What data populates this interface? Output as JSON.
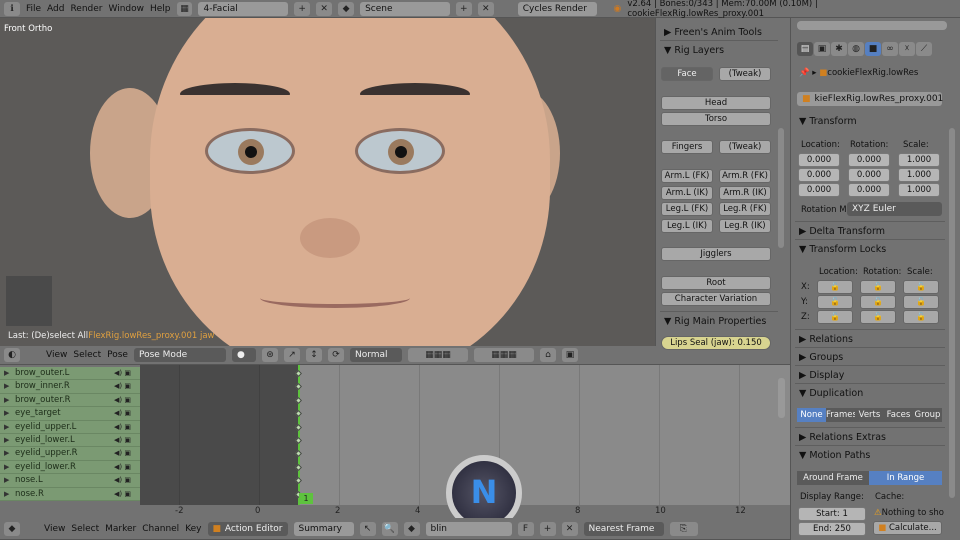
{
  "topbar": {
    "menus": [
      "File",
      "Add",
      "Render",
      "Window",
      "Help"
    ],
    "screen_layout": "4-Facial",
    "scene": "Scene",
    "render_engine": "Cycles Render",
    "stats": "v2.64 | Bones:0/343 | Mem:70.00M (0.10M) | cookieFlexRig.lowRes_proxy.001"
  },
  "viewport": {
    "view_label": "Front Ortho",
    "last_op": "Last: (De)select All",
    "object_info": "FlexRig.lowRes_proxy.001 jaw",
    "menus": [
      "View",
      "Select",
      "Pose"
    ],
    "mode": "Pose Mode",
    "orientation": "Normal"
  },
  "npanel": {
    "anim_tools": "Freen's Anim Tools",
    "rig_layers": "Rig Layers",
    "buttons": {
      "face": "Face",
      "tweak1": "(Tweak)",
      "head": "Head",
      "torso": "Torso",
      "fingers": "Fingers",
      "tweak2": "(Tweak)",
      "arm_l_fk": "Arm.L (FK)",
      "arm_r_fk": "Arm.R (FK)",
      "arm_l_ik": "Arm.L (IK)",
      "arm_r_ik": "Arm.R (IK)",
      "leg_l_fk": "Leg.L (FK)",
      "leg_r_fk": "Leg.R (FK)",
      "leg_l_ik": "Leg.L (IK)",
      "leg_r_ik": "Leg.R (IK)",
      "jigglers": "Jigglers",
      "root": "Root",
      "char_var": "Character Variation"
    },
    "main_props": "Rig Main Properties",
    "lips_seal": "Lips Seal (jaw): 0.150"
  },
  "props": {
    "breadcrumb": "cookieFlexRig.lowRes",
    "object_name": "kieFlexRig.lowRes_proxy.001",
    "transform": "Transform",
    "location": "Location:",
    "rotation": "Rotation:",
    "scale": "Scale:",
    "loc": [
      "0.000",
      "0.000",
      "0.000"
    ],
    "rot": [
      "0.000",
      "0.000",
      "0.000"
    ],
    "scl": [
      "1.000",
      "1.000",
      "1.000"
    ],
    "rotation_mode_label": "Rotation M",
    "rotation_mode": "XYZ Euler",
    "delta": "Delta Transform",
    "locks": "Transform Locks",
    "axes": [
      "X:",
      "Y:",
      "Z:"
    ],
    "relations": "Relations",
    "groups": "Groups",
    "display": "Display",
    "duplication": "Duplication",
    "dup_opts": [
      "None",
      "Frames",
      "Verts",
      "Faces",
      "Group"
    ],
    "relations_extras": "Relations Extras",
    "motion_paths": "Motion Paths",
    "around_frame": "Around Frame",
    "in_range": "In Range",
    "display_range": "Display Range:",
    "cache": "Cache:",
    "start": "Start: 1",
    "end": "End: 250",
    "nothing": "Nothing to sho",
    "calculate": "Calculate..."
  },
  "dopesheet": {
    "channels": [
      "brow_outer.L",
      "brow_inner.R",
      "brow_outer.R",
      "eye_target",
      "eyelid_upper.L",
      "eyelid_lower.L",
      "eyelid_upper.R",
      "eyelid_lower.R",
      "nose.L",
      "nose.R"
    ],
    "ticks": [
      "-2",
      "0",
      "2",
      "4",
      "6",
      "8",
      "10",
      "12"
    ],
    "current_frame": "1",
    "menus": [
      "View",
      "Select",
      "Marker",
      "Channel",
      "Key"
    ],
    "editor_mode": "Action Editor",
    "summary": "Summary",
    "action": "blin",
    "fake_user": "F",
    "snap": "Nearest Frame"
  },
  "colors": {
    "selection_blue": "#5680c2",
    "channel_green": "#7b9a73",
    "current_frame": "#5ec23e"
  }
}
